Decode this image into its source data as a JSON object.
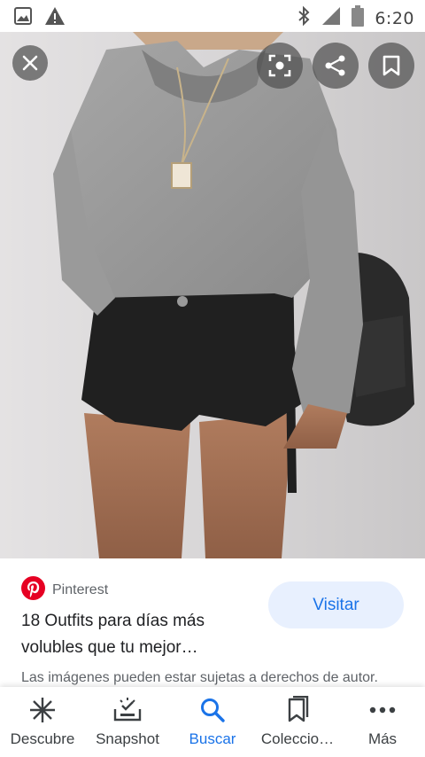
{
  "status_bar": {
    "time": "6:20",
    "icons": [
      "gallery-icon",
      "warning-icon",
      "bluetooth-icon",
      "signal-icon",
      "battery-icon"
    ]
  },
  "viewer": {
    "buttons": [
      "close-icon",
      "lens-icon",
      "share-icon",
      "bookmark-icon"
    ]
  },
  "result": {
    "source": "Pinterest",
    "title": "18 Outfits para días más volubles que tu mejor…",
    "visit_label": "Visitar",
    "rights_notice": "Las imágenes pueden estar sujetas a derechos de autor."
  },
  "bottom_nav": {
    "items": [
      {
        "label": "Descubre",
        "icon": "asterisk-icon"
      },
      {
        "label": "Snapshot",
        "icon": "snapshot-icon"
      },
      {
        "label": "Buscar",
        "icon": "search-icon",
        "active": true
      },
      {
        "label": "Coleccio…",
        "icon": "collections-icon"
      },
      {
        "label": "Más",
        "icon": "more-icon"
      }
    ]
  },
  "colors": {
    "accent": "#1a73e8",
    "visit_bg": "#e8f0fe",
    "pinterest": "#e60023",
    "overlay_button": "#505050"
  }
}
